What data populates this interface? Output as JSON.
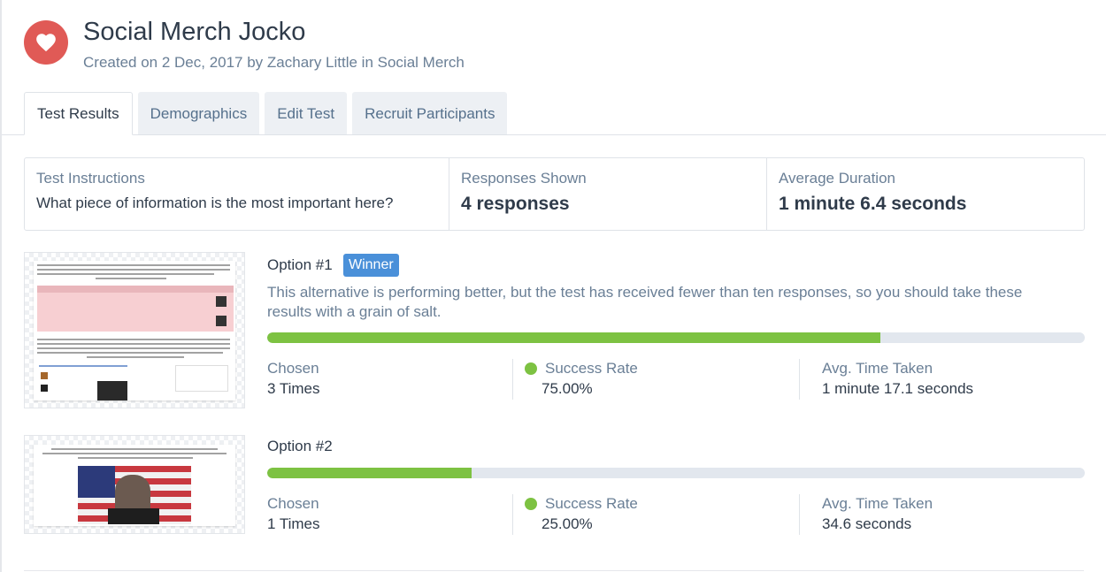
{
  "header": {
    "icon": "heart-icon",
    "icon_color": "#e05a56",
    "title": "Social Merch Jocko",
    "subtitle": "Created on 2 Dec, 2017 by Zachary Little in Social Merch"
  },
  "tabs": [
    {
      "label": "Test Results",
      "active": true
    },
    {
      "label": "Demographics",
      "active": false
    },
    {
      "label": "Edit Test",
      "active": false
    },
    {
      "label": "Recruit Participants",
      "active": false
    }
  ],
  "summary": {
    "instructions_label": "Test Instructions",
    "instructions_value": "What piece of information is the most important here?",
    "responses_label": "Responses Shown",
    "responses_value": "4 responses",
    "duration_label": "Average Duration",
    "duration_value": "1 minute 6.4 seconds"
  },
  "options": [
    {
      "title": "Option #1",
      "badge": "Winner",
      "description": "This alternative is performing better, but the test has received fewer than ten responses, so you should take these results with a grain of salt.",
      "success_fraction": 0.75,
      "chosen_label": "Chosen",
      "chosen_value": "3 Times",
      "success_label": "Success Rate",
      "success_value": "75.00%",
      "time_label": "Avg. Time Taken",
      "time_value": "1 minute 17.1 seconds"
    },
    {
      "title": "Option #2",
      "success_fraction": 0.25,
      "chosen_label": "Chosen",
      "chosen_value": "1 Times",
      "success_label": "Success Rate",
      "success_value": "25.00%",
      "time_label": "Avg. Time Taken",
      "time_value": "34.6 seconds"
    }
  ],
  "colors": {
    "accent_green": "#7dc242",
    "badge_blue": "#4a90d9",
    "track": "#e2e7ee"
  }
}
